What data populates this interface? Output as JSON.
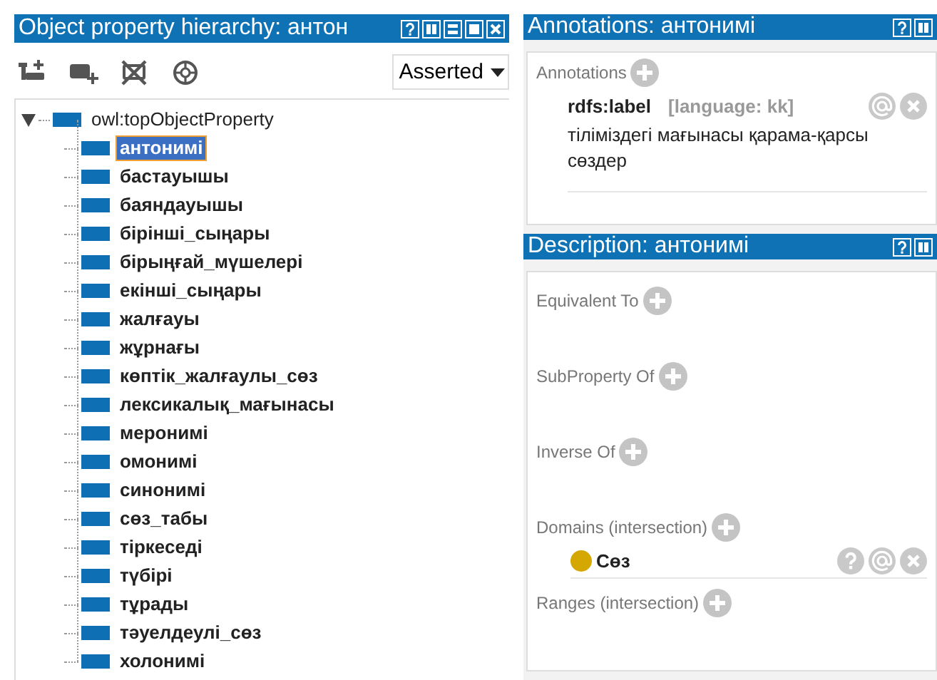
{
  "hierarchy": {
    "title": "Object property hierarchy: антон",
    "view": "Asserted",
    "tree": [
      {
        "label": "owl:topObjectProperty",
        "expanded": true,
        "selected": false,
        "children": [
          {
            "label": "антонимі",
            "selected": true
          },
          {
            "label": "бастауышы",
            "selected": false
          },
          {
            "label": "баяндауышы",
            "selected": false
          },
          {
            "label": "бірінші_сыңары",
            "selected": false
          },
          {
            "label": "бірыңғай_мүшелері",
            "selected": false
          },
          {
            "label": "екінші_сыңары",
            "selected": false
          },
          {
            "label": "жалғауы",
            "selected": false
          },
          {
            "label": "жұрнағы",
            "selected": false
          },
          {
            "label": "көптік_жалғаулы_сөз",
            "selected": false
          },
          {
            "label": "лексикалық_мағынасы",
            "selected": false
          },
          {
            "label": "меронимі",
            "selected": false
          },
          {
            "label": "омонимі",
            "selected": false
          },
          {
            "label": "синонимі",
            "selected": false
          },
          {
            "label": "сөз_табы",
            "selected": false
          },
          {
            "label": "тіркеседі",
            "selected": false
          },
          {
            "label": "түбірі",
            "selected": false
          },
          {
            "label": "тұрады",
            "selected": false
          },
          {
            "label": "тәуелдеулі_сөз",
            "selected": false
          },
          {
            "label": "холонимі",
            "selected": false
          }
        ]
      }
    ]
  },
  "annotations": {
    "title": "Annotations: антонимі",
    "section": "Annotations",
    "items": [
      {
        "property": "rdfs:label",
        "language": "[language: kk]",
        "value": "тіліміздегі мағынасы қарама-қарсы сөздер"
      }
    ]
  },
  "description": {
    "title": "Description: антонимі",
    "sections": [
      {
        "label": "Equivalent To"
      },
      {
        "label": "SubProperty Of"
      },
      {
        "label": "Inverse Of"
      },
      {
        "label": "Domains (intersection)",
        "items": [
          {
            "label": "Сөз",
            "color": "#d4a800"
          }
        ]
      },
      {
        "label": "Ranges (intersection)"
      }
    ]
  }
}
